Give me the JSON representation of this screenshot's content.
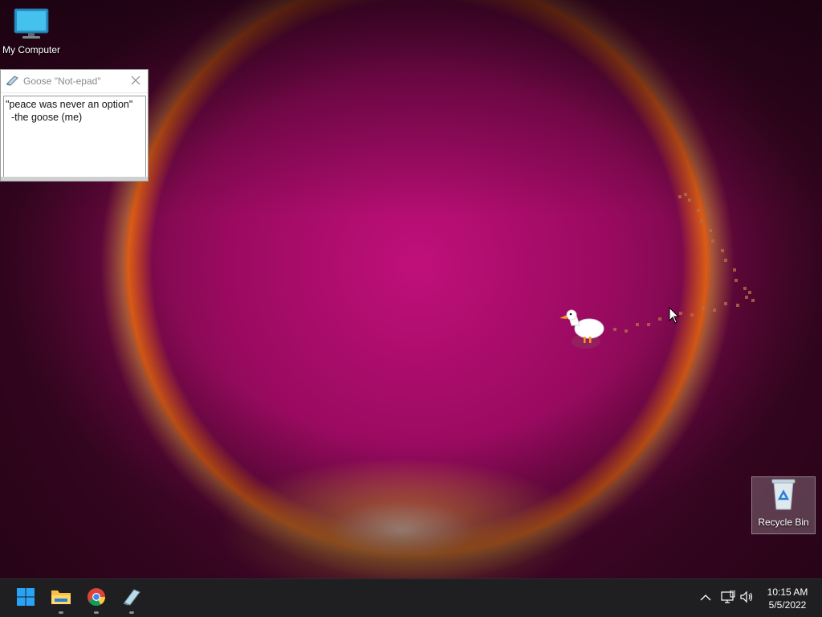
{
  "desktop": {
    "icons": [
      {
        "label": "My Computer",
        "icon": "monitor-icon"
      },
      {
        "label": "Recycle Bin",
        "icon": "recycle-bin-icon"
      }
    ]
  },
  "notepad": {
    "title": "Goose \"Not-epad\"",
    "icon": "notepad-icon",
    "text": "\"peace was never an option\"\n  -the goose (me)"
  },
  "taskbar": {
    "apps": [
      {
        "name": "Start",
        "icon": "windows-start-icon"
      },
      {
        "name": "File Explorer",
        "icon": "folder-icon"
      },
      {
        "name": "Chrome",
        "icon": "chrome-icon"
      },
      {
        "name": "Notepad",
        "icon": "notepad-icon"
      }
    ],
    "tray": {
      "chevron": "chevron-up-icon",
      "network": "network-icon",
      "volume": "volume-icon"
    },
    "clock": {
      "time": "10:15 AM",
      "date": "5/5/2022"
    }
  },
  "colors": {
    "taskbar": "#1f1f22",
    "accent": "#0a84ff",
    "goose_beak": "#f59a1c"
  }
}
